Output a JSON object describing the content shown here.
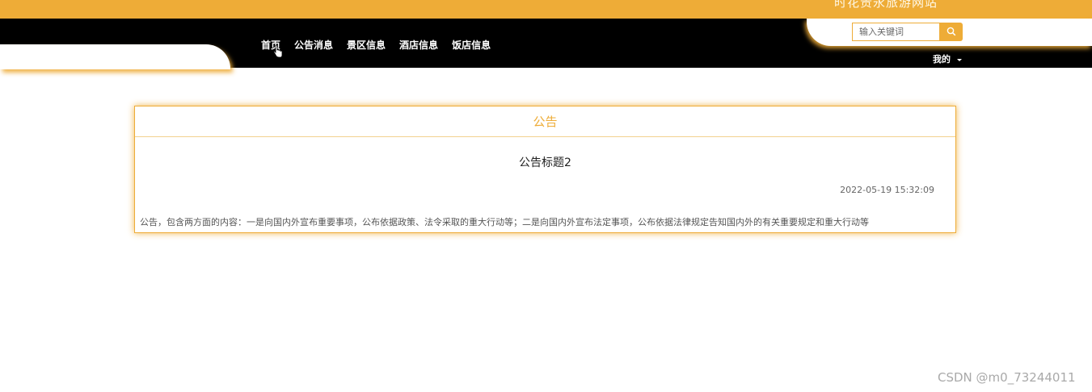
{
  "header": {
    "site_title": "时花贵永旅游网站",
    "nav_items": [
      "首页",
      "公告消息",
      "景区信息",
      "酒店信息",
      "饭店信息"
    ],
    "search": {
      "placeholder": "输入关键词"
    },
    "my_menu": "我的"
  },
  "card": {
    "header_title": "公告",
    "notice_title": "公告标题2",
    "notice_time": "2022-05-19 15:32:09",
    "notice_content": "公告，包含两方面的内容：一是向国内外宣布重要事项，公布依据政策、法令采取的重大行动等；二是向国内外宣布法定事项，公布依据法律规定告知国内外的有关重要规定和重大行动等"
  },
  "watermark": "CSDN @m0_73244011",
  "colors": {
    "accent": "#eeac37",
    "nav_bg": "#000000"
  },
  "icons": {
    "search": "search-icon",
    "cursor": "hand-cursor-icon",
    "caret": "caret-down-icon"
  }
}
